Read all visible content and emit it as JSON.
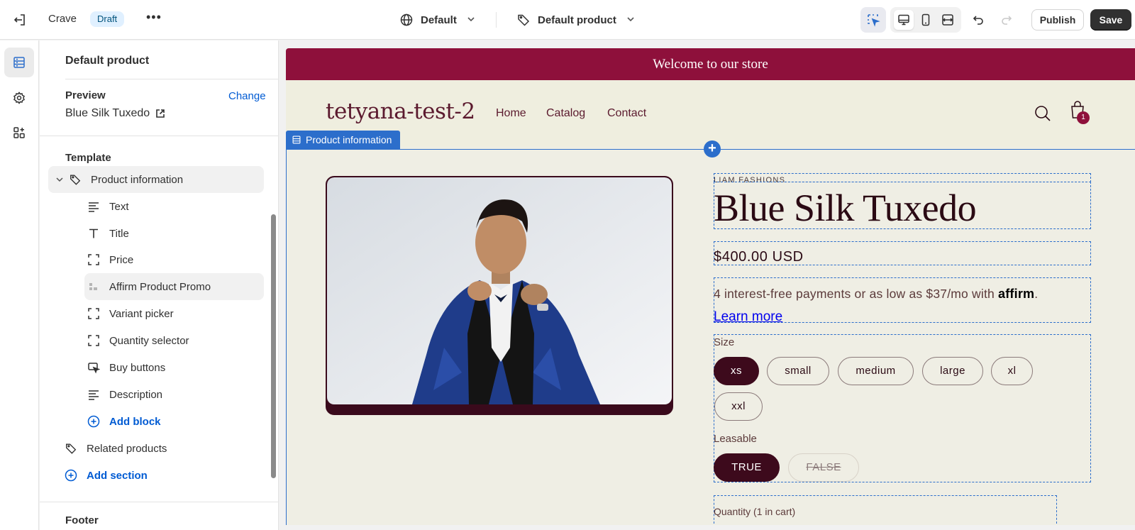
{
  "topbar": {
    "store_name": "Crave",
    "status_badge": "Draft",
    "theme_selector": "Default",
    "template_selector": "Default product",
    "publish_label": "Publish",
    "save_label": "Save"
  },
  "sidebar": {
    "title": "Default product",
    "preview_label": "Preview",
    "change_link": "Change",
    "preview_product": "Blue Silk Tuxedo",
    "template_label": "Template",
    "section_name": "Product information",
    "blocks": [
      {
        "label": "Text",
        "icon": "text-lines-icon"
      },
      {
        "label": "Title",
        "icon": "title-t-icon"
      },
      {
        "label": "Price",
        "icon": "dashed-square-icon"
      },
      {
        "label": "Affirm Product Promo",
        "icon": "app-block-icon"
      },
      {
        "label": "Variant picker",
        "icon": "dashed-square-icon"
      },
      {
        "label": "Quantity selector",
        "icon": "dashed-square-icon"
      },
      {
        "label": "Buy buttons",
        "icon": "cursor-click-icon"
      },
      {
        "label": "Description",
        "icon": "text-lines-icon"
      }
    ],
    "add_block": "Add block",
    "related_products": "Related products",
    "add_section": "Add section",
    "footer_label": "Footer"
  },
  "storefront": {
    "announcement": "Welcome to our store",
    "logo": "tetyana-test-2",
    "nav": [
      "Home",
      "Catalog",
      "Contact"
    ],
    "cart_count": "1",
    "section_tag": "Product information",
    "vendor": "LIAM FASHIONS",
    "product_title": "Blue Silk Tuxedo",
    "price": "$400.00 USD",
    "affirm_text": "4 interest-free payments or as low as $37/mo with",
    "affirm_brand": "affirm",
    "affirm_period": ".",
    "learn_more": "Learn more",
    "size_label": "Size",
    "sizes": [
      "xs",
      "small",
      "medium",
      "large",
      "xl",
      "xxl"
    ],
    "selected_size": "xs",
    "leasable_label": "Leasable",
    "leasable_options": [
      "TRUE",
      "FALSE"
    ],
    "quantity_label": "Quantity (1 in cart)"
  },
  "colors": {
    "accent": "#2c6ecb",
    "brand": "#8e103b",
    "selected_pill": "#3d0a1c"
  }
}
